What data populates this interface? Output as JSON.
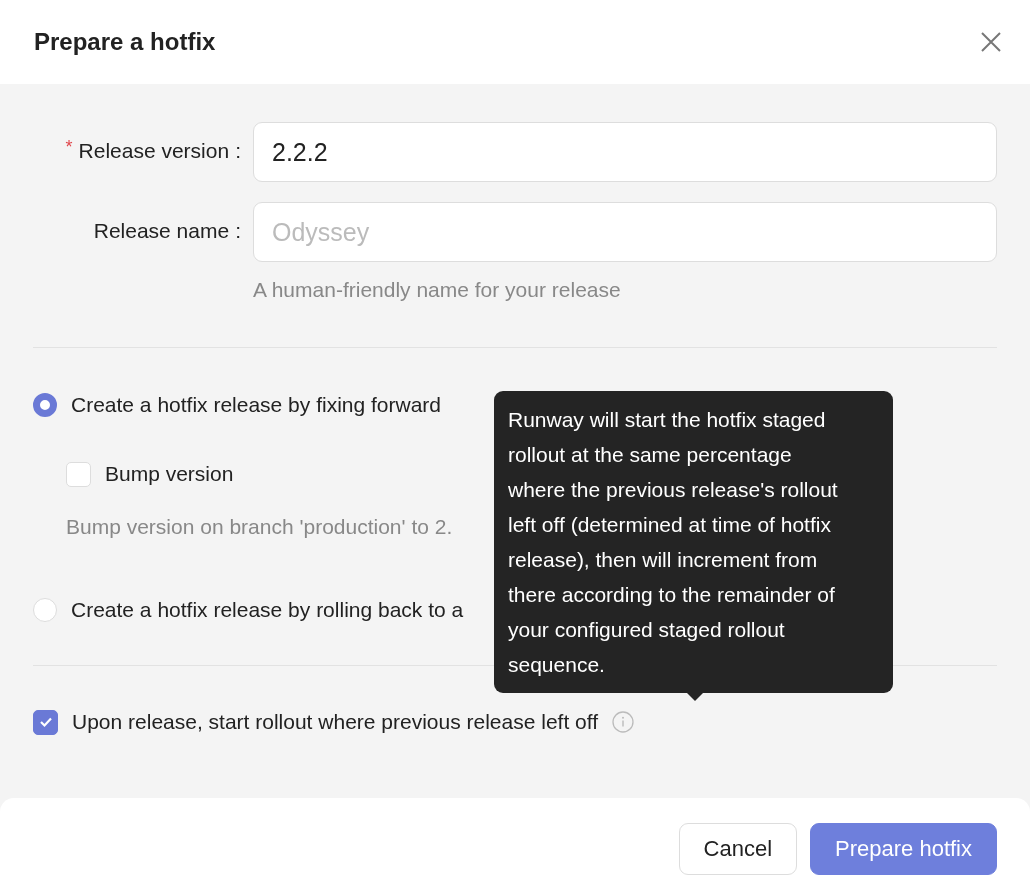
{
  "dialog": {
    "title": "Prepare a hotfix"
  },
  "required_marker": "*",
  "fields": [
    {
      "label": "Release version",
      "colon": ":",
      "required": true,
      "value": "2.2.2"
    },
    {
      "label": "Release name",
      "colon": ":",
      "required": false,
      "placeholder": "Odyssey",
      "help": "A human-friendly name for your release"
    }
  ],
  "options": [
    {
      "label": "Create a hotfix release by fixing forward",
      "selected": true,
      "sub": {
        "label": "Bump version",
        "checked": false,
        "help": "Bump version on branch 'production' to 2."
      }
    },
    {
      "label": "Create a hotfix release by rolling back to a",
      "selected": false
    }
  ],
  "rollout_checkbox": {
    "label": "Upon release, start rollout where previous release left off",
    "checked": true
  },
  "tooltip": {
    "text": "Runway will start the hotfix staged rollout at the same percentage where the previous release's rollout left off (determined at time of hotfix release), then will increment from there according to the remainder of your configured staged rollout sequence."
  },
  "buttons": [
    {
      "label": "Cancel",
      "kind": "secondary"
    },
    {
      "label": "Prepare hotfix",
      "kind": "primary"
    }
  ]
}
